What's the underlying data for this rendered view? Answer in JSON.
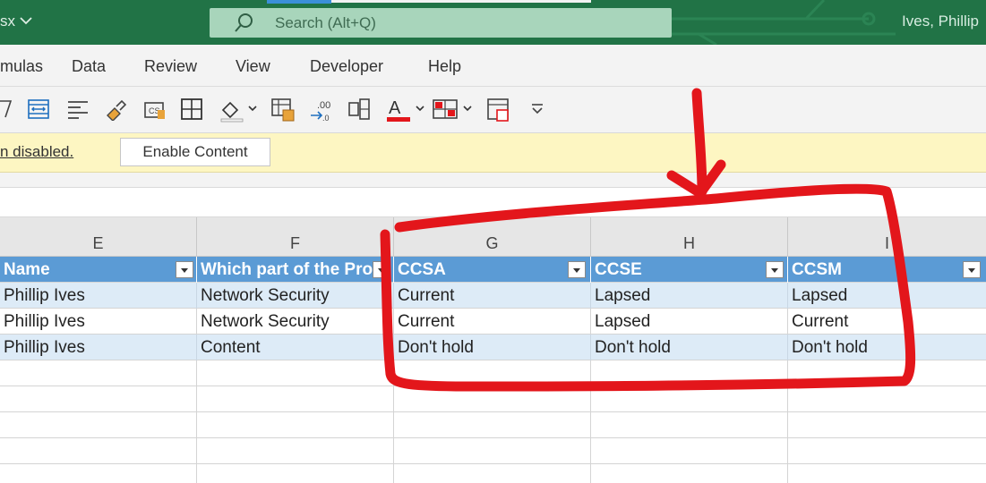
{
  "titlebar": {
    "file_fragment": "sx",
    "search_placeholder": "Search (Alt+Q)",
    "user_name": "Ives, Phillip"
  },
  "ribbon_tabs": [
    "mulas",
    "Data",
    "Review",
    "View",
    "Developer",
    "Help"
  ],
  "toolbar_icons": [
    "filter-icon",
    "wrap-text-icon",
    "align-icon",
    "format-painter-icon",
    "cell-styles-icon",
    "borders-icon",
    "fill-color-icon",
    "format-as-table-icon",
    "increase-decimal-icon",
    "merge-icon",
    "font-color-icon",
    "conditional-format-icon",
    "page-setup-icon",
    "more-options-icon"
  ],
  "message_bar": {
    "text": "n disabled.",
    "button_label": "Enable Content"
  },
  "columns": [
    "E",
    "F",
    "G",
    "H",
    "I"
  ],
  "table": {
    "headers": [
      "Name",
      "Which part of the Pro",
      "CCSA",
      "CCSE",
      "CCSM"
    ],
    "rows": [
      [
        "Phillip Ives",
        "Network Security",
        "Current",
        "Lapsed",
        "Lapsed"
      ],
      [
        "Phillip Ives",
        "Network Security",
        "Current",
        "Lapsed",
        "Current"
      ],
      [
        "Phillip Ives",
        "Content",
        "Don't hold",
        "Don't hold",
        "Don't hold"
      ]
    ]
  },
  "colors": {
    "title_bar": "#217346",
    "table_header": "#5b9bd5",
    "band_row": "#ddebf7",
    "message_bar": "#fdf6c2",
    "annotation": "#e3161b"
  }
}
